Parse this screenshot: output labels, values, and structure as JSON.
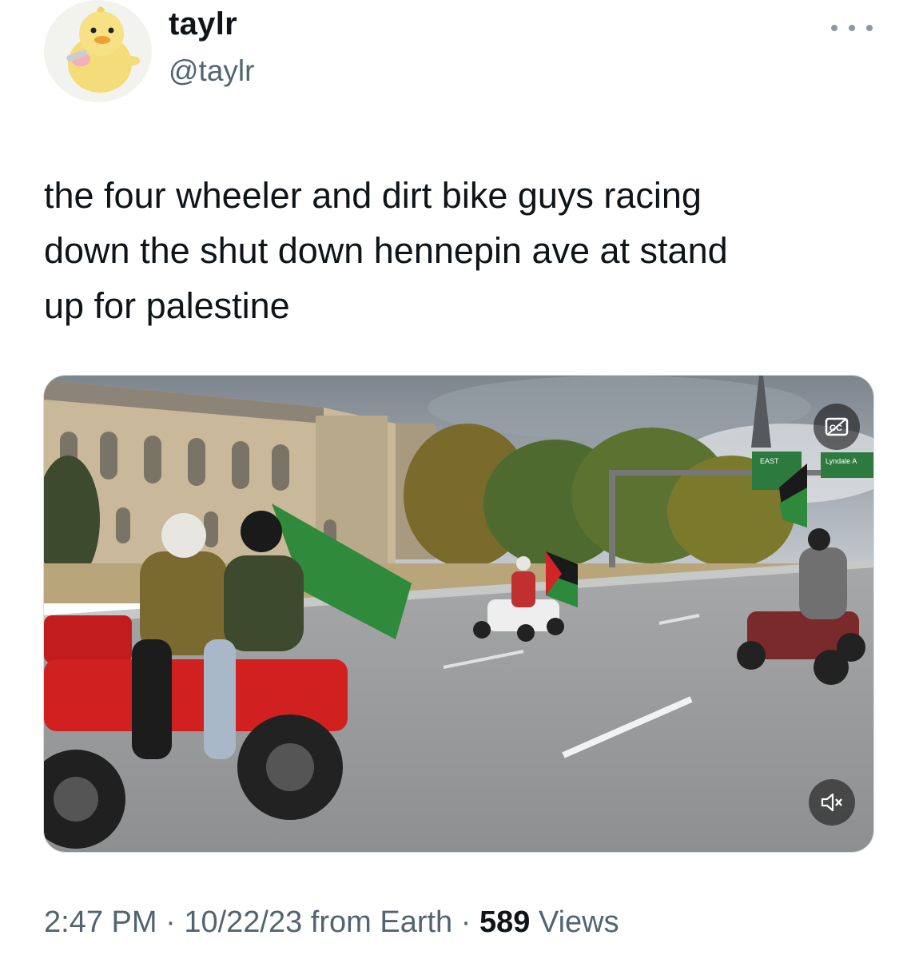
{
  "author": {
    "display_name": "taylr",
    "handle": "@taylr",
    "avatar_icon": "duck-avatar-icon"
  },
  "tweet": {
    "text": "the four wheeler and dirt bike guys racing\ndown the shut down hennepin ave at stand\nup for palestine"
  },
  "media": {
    "overlay_icons": [
      "closed-captions-icon",
      "muted-speaker-icon"
    ],
    "road_sign_left": "EAST",
    "road_sign_right": "Lyndale A"
  },
  "meta": {
    "time": "2:47 PM",
    "date": "10/22/23",
    "source": "from Earth",
    "views_count": "589",
    "views_label": "Views",
    "separator": "·"
  },
  "colors": {
    "text_primary": "#0f1419",
    "text_secondary": "#536471"
  }
}
